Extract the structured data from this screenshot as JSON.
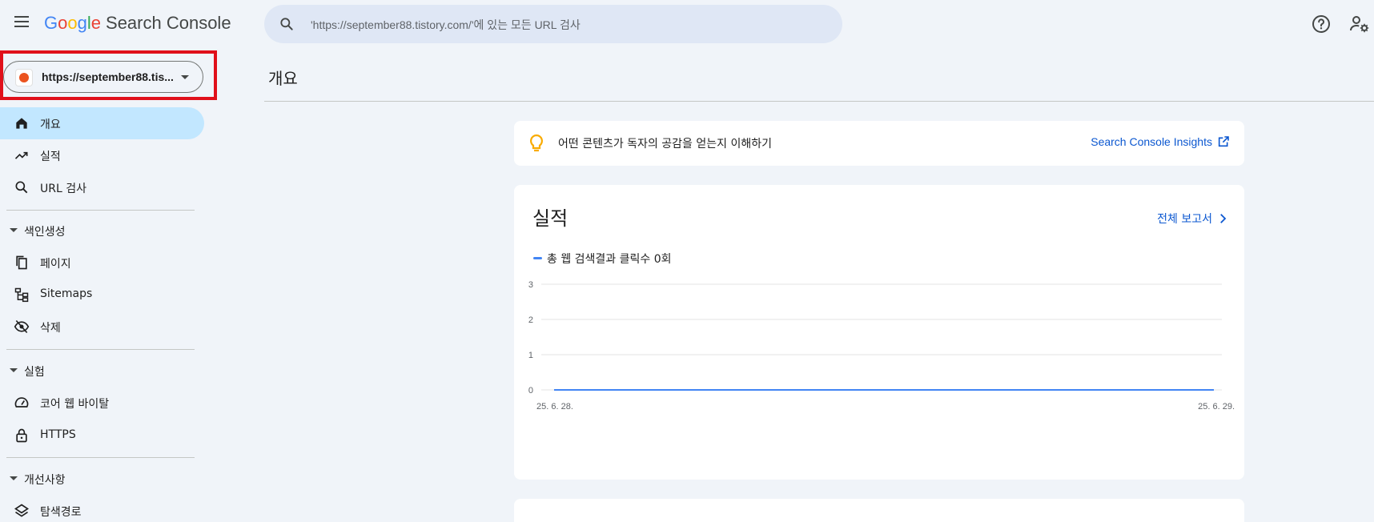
{
  "header": {
    "logo": {
      "g1": "G",
      "o1": "o",
      "o2": "o",
      "g2": "g",
      "l": "l",
      "e": "e",
      "product": "Search Console"
    },
    "search_placeholder": "'https://september88.tistory.com/'에 있는 모든 URL 검사"
  },
  "property": {
    "label": "https://september88.tis..."
  },
  "sidebar": {
    "items": [
      {
        "label": "개요",
        "icon": "home-icon",
        "active": true
      },
      {
        "label": "실적",
        "icon": "trending-up-icon"
      },
      {
        "label": "URL 검사",
        "icon": "search-icon"
      }
    ],
    "sections": [
      {
        "label": "색인생성",
        "items": [
          {
            "label": "페이지",
            "icon": "pages-icon"
          },
          {
            "label": "Sitemaps",
            "icon": "sitemap-icon"
          },
          {
            "label": "삭제",
            "icon": "eye-off-icon"
          }
        ]
      },
      {
        "label": "실험",
        "items": [
          {
            "label": "코어 웹 바이탈",
            "icon": "speedometer-icon"
          },
          {
            "label": "HTTPS",
            "icon": "lock-icon"
          }
        ]
      },
      {
        "label": "개선사항",
        "items": [
          {
            "label": "탐색경로",
            "icon": "layers-icon"
          }
        ]
      }
    ]
  },
  "main": {
    "title": "개요",
    "insights": {
      "text": "어떤 콘텐츠가 독자의 공감을 얻는지 이해하기",
      "link": "Search Console Insights"
    },
    "performance": {
      "title": "실적",
      "report_link": "전체 보고서",
      "legend": "총 웹 검색결과 클릭수 0회"
    }
  },
  "colors": {
    "accent": "#0b57d0",
    "active_nav": "#c2e7ff",
    "series": "#4285f4",
    "highlight": "#e0101a"
  },
  "chart_data": {
    "type": "line",
    "title": "",
    "xlabel": "",
    "ylabel": "",
    "x": [
      "25. 6. 28.",
      "25. 6. 29."
    ],
    "series": [
      {
        "name": "총 웹 검색결과 클릭수 0회",
        "values": [
          0,
          0
        ]
      }
    ],
    "ylim": [
      0,
      3
    ],
    "yticks": [
      "0",
      "1",
      "2",
      "3"
    ],
    "grid": true
  }
}
